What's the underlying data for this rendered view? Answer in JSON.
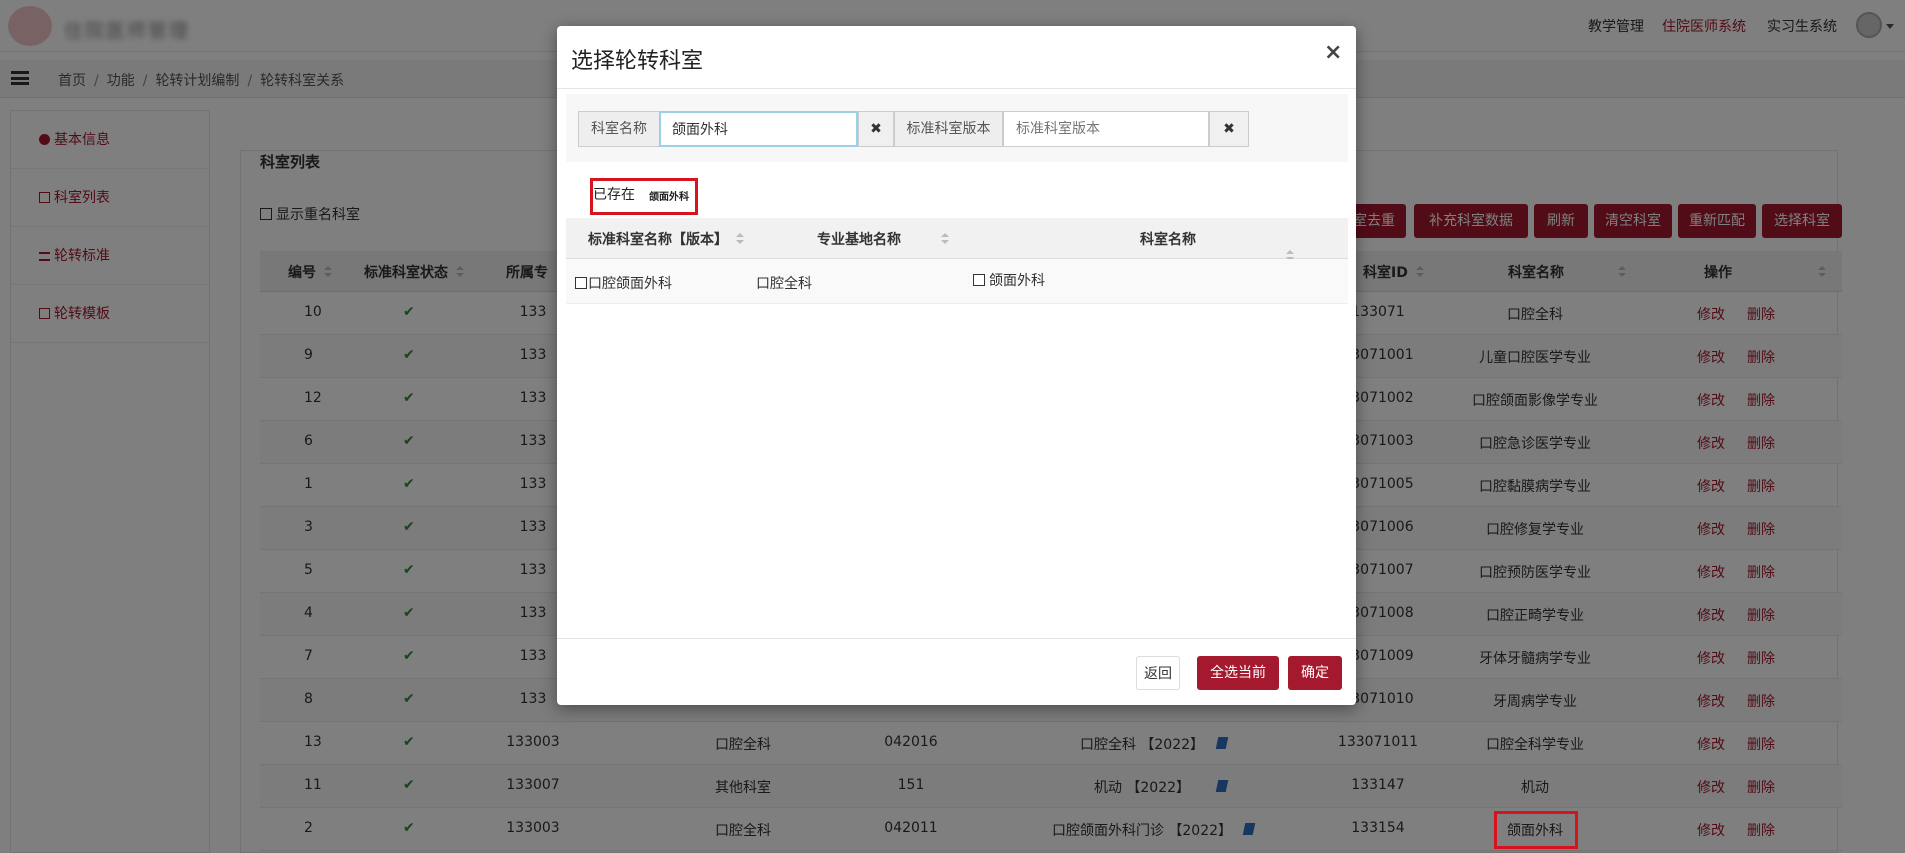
{
  "header": {
    "nav": [
      "教学管理",
      "住院医师系统",
      "实习生系统"
    ],
    "active_nav": "住院医师系统",
    "colors": {
      "brand": "#a5192e",
      "highlight": "#d7141e",
      "success": "#2e8b3c"
    }
  },
  "breadcrumb": [
    "首页",
    "功能",
    "轮转计划编制",
    "轮转科室关系"
  ],
  "sidebar": {
    "items": [
      {
        "label": "基本信息",
        "icon": "info-circle-icon"
      },
      {
        "label": "科室列表",
        "icon": "clipboard-icon"
      },
      {
        "label": "轮转标准",
        "icon": "list-icon"
      },
      {
        "label": "轮转模板",
        "icon": "document-icon"
      }
    ]
  },
  "main": {
    "title": "科室列表",
    "show_duplicates_label": "显示重名科室",
    "toolbar": [
      "室去重",
      "补充科室数据",
      "刷新",
      "清空科室",
      "重新匹配",
      "选择科室"
    ],
    "columns": [
      "编号",
      "标准科室状态",
      "所属专",
      "",
      "",
      "",
      "科室ID",
      "科室名称",
      "操作"
    ],
    "edit_label": "修改",
    "delete_label": "删除",
    "rows": [
      {
        "no": "10",
        "base": "133",
        "dept_id": "133071",
        "name": "口腔全科"
      },
      {
        "no": "9",
        "base": "133",
        "dept_id": "33071001",
        "name": "儿童口腔医学专业"
      },
      {
        "no": "12",
        "base": "133",
        "dept_id": "33071002",
        "name": "口腔颌面影像学专业"
      },
      {
        "no": "6",
        "base": "133",
        "dept_id": "33071003",
        "name": "口腔急诊医学专业"
      },
      {
        "no": "1",
        "base": "133",
        "dept_id": "33071005",
        "name": "口腔黏膜病学专业"
      },
      {
        "no": "3",
        "base": "133",
        "dept_id": "33071006",
        "name": "口腔修复学专业"
      },
      {
        "no": "5",
        "base": "133",
        "dept_id": "33071007",
        "name": "口腔预防医学专业"
      },
      {
        "no": "4",
        "base": "133",
        "dept_id": "33071008",
        "name": "口腔正畸学专业"
      },
      {
        "no": "7",
        "base": "133",
        "dept_id": "33071009",
        "name": "牙体牙髓病学专业"
      },
      {
        "no": "8",
        "base": "133",
        "dept_id": "33071010",
        "name": "牙周病学专业"
      },
      {
        "no": "13",
        "base": "133003",
        "specialty": "口腔全科",
        "code": "042016",
        "standard": "口腔全科 【2022】",
        "dept_id": "133071011",
        "name": "口腔全科学专业"
      },
      {
        "no": "11",
        "base": "133007",
        "specialty": "其他科室",
        "code": "151",
        "standard": "机动 【2022】",
        "dept_id": "133147",
        "name": "机动"
      },
      {
        "no": "2",
        "base": "133003",
        "specialty": "口腔全科",
        "code": "042011",
        "standard": "口腔颌面外科门诊 【2022】",
        "dept_id": "133154",
        "name": "颌面外科"
      }
    ]
  },
  "modal": {
    "title": "选择轮转科室",
    "close_glyph": "×",
    "search": {
      "dept_name_label": "科室名称",
      "dept_name_value": "颌面外科",
      "std_version_label": "标准科室版本",
      "std_version_placeholder": "标准科室版本",
      "clear_glyph": "✖"
    },
    "exists_label": "已存在",
    "exists_name": "颌面外科",
    "columns": [
      "标准科室名称【版本】",
      "专业基地名称",
      "科室名称"
    ],
    "rows": [
      {
        "standard": "口腔颌面外科",
        "base": "口腔全科",
        "dept": "颌面外科"
      }
    ],
    "buttons": {
      "back": "返回",
      "select_all": "全选当前",
      "confirm": "确定"
    }
  }
}
